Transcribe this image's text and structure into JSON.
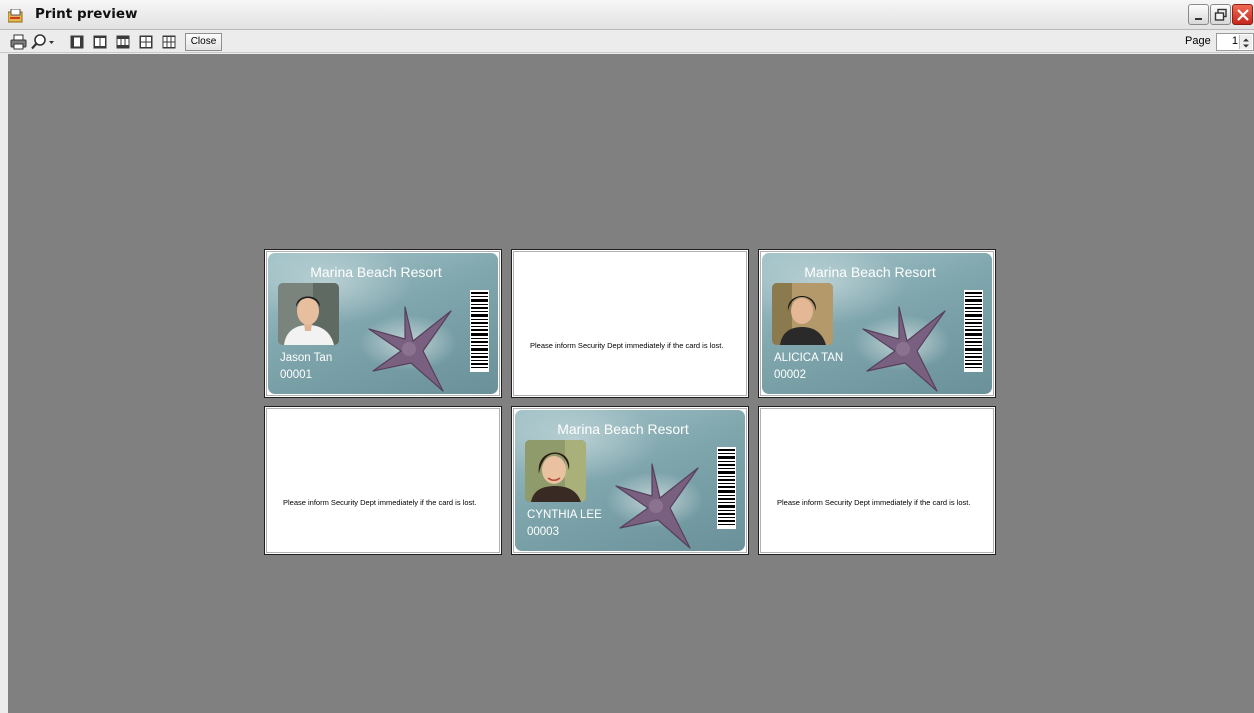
{
  "window": {
    "title": "Print preview",
    "icons": [
      "app-icon",
      "minimize-icon",
      "restore-icon",
      "close-icon"
    ]
  },
  "toolbar": {
    "icons": [
      "print-icon",
      "zoom-icon",
      "one-page-icon",
      "two-pages-icon",
      "three-pages-icon",
      "four-pages-icon",
      "six-pages-icon"
    ],
    "close_label": "Close",
    "page_label": "Page",
    "page_value": "1"
  },
  "cards": [
    {
      "resort": "Marina Beach Resort",
      "name": "Jason Tan",
      "id": "00001",
      "photo": "male-portrait"
    },
    {
      "resort": "Marina Beach Resort",
      "name": "ALICICA TAN",
      "id": "00002",
      "photo": "female-portrait"
    },
    {
      "resort": "Marina Beach Resort",
      "name": "CYNTHIA LEE",
      "id": "00003",
      "photo": "female-portrait"
    }
  ],
  "card_back": {
    "text": "Please inform Security Dept immediately if the card is lost."
  },
  "colors": {
    "preview_background": "#808080",
    "card_teal": "#7fa6ad",
    "titlebar_close": "#c4281c"
  }
}
